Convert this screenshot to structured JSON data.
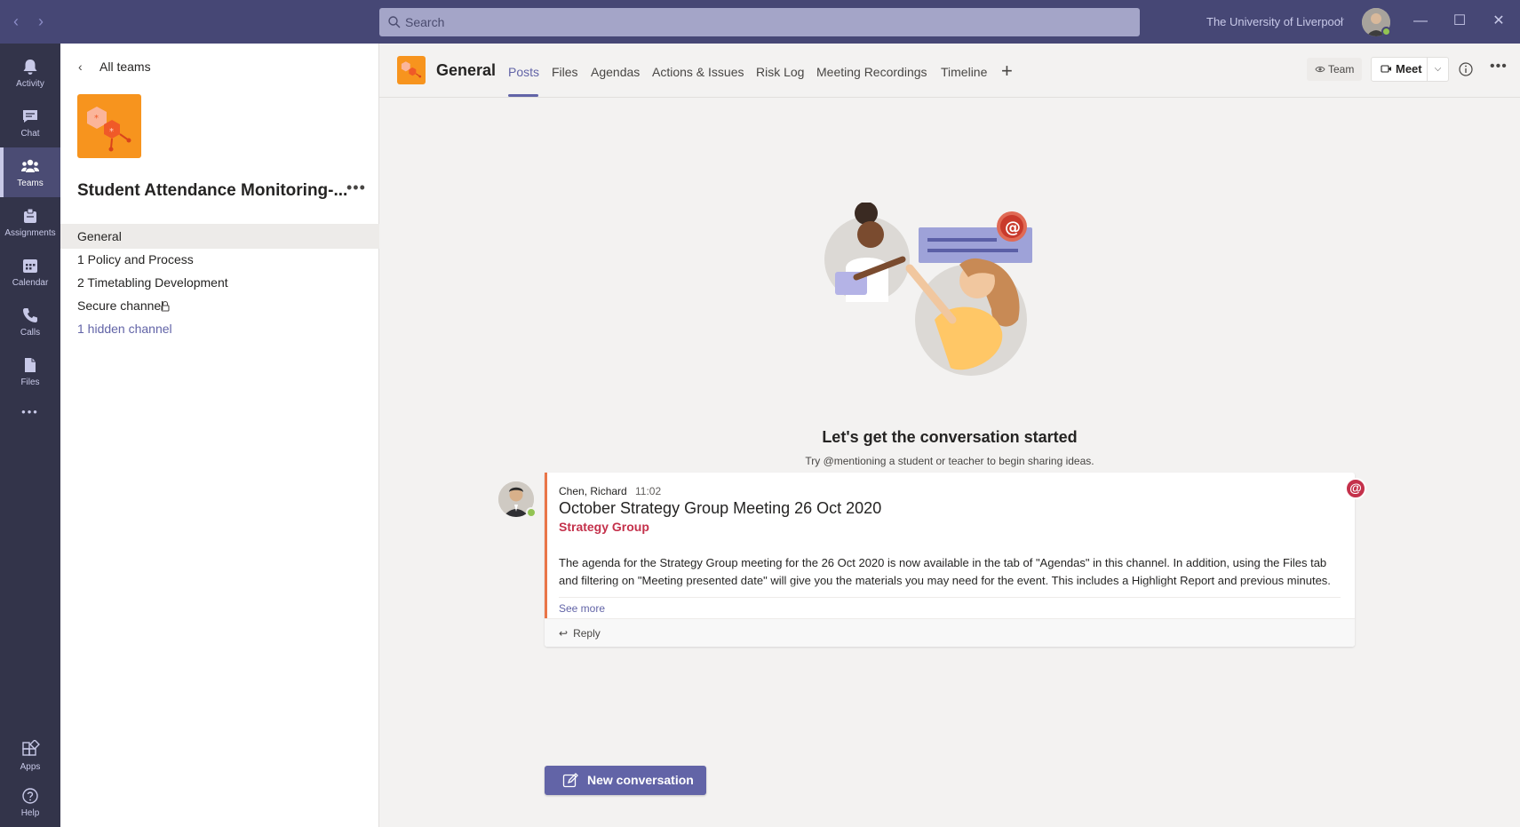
{
  "titlebar": {
    "search_placeholder": "Search",
    "org_name": "The University of Liverpool",
    "back_glyph": "‹",
    "forward_glyph": "›",
    "org_chevron": "⌵",
    "minimize_glyph": "—",
    "maximize_glyph": "☐",
    "close_glyph": "✕"
  },
  "rail": {
    "items": [
      {
        "label": "Activity",
        "icon": "bell-icon"
      },
      {
        "label": "Chat",
        "icon": "chat-icon"
      },
      {
        "label": "Teams",
        "icon": "teams-icon"
      },
      {
        "label": "Assignments",
        "icon": "assignments-icon"
      },
      {
        "label": "Calendar",
        "icon": "calendar-icon"
      },
      {
        "label": "Calls",
        "icon": "phone-icon"
      },
      {
        "label": "Files",
        "icon": "file-icon"
      }
    ],
    "more_glyph": "•••",
    "apps_label": "Apps",
    "help_label": "Help"
  },
  "pane": {
    "back_label": "All teams",
    "back_glyph": "‹",
    "team_name": "Student Attendance Monitoring-...",
    "more_glyph": "•••",
    "channels": [
      "General",
      "1 Policy and Process",
      "2 Timetabling Development",
      "Secure channel",
      "1 hidden channel"
    ]
  },
  "header": {
    "channel_title": "General",
    "tabs": [
      "Posts",
      "Files",
      "Agendas",
      "Actions & Issues",
      "Risk Log",
      "Meeting Recordings",
      "Timeline"
    ],
    "add_tab_glyph": "+",
    "team_button": "Team",
    "meet_button": "Meet",
    "meet_dropdown_glyph": "⌵",
    "more_glyph": "•••"
  },
  "empty_state": {
    "title": "Let's get the conversation started",
    "subtitle": "Try @mentioning a student or teacher to begin sharing ideas."
  },
  "post": {
    "author": "Chen, Richard",
    "time": "11:02",
    "subject": "October Strategy Group Meeting 26 Oct 2020",
    "tag": "Strategy Group",
    "body": "The agenda for the Strategy Group meeting for the 26 Oct 2020 is now available in the tab of \"Agendas\" in this channel.  In addition, using the Files tab and filtering on \"Meeting presented date\" will give you the materials you may need for the event. This includes a Highlight Report and previous minutes.",
    "see_more": "See more",
    "reply": "Reply",
    "reply_glyph": "↩",
    "mention_glyph": "@"
  },
  "compose": {
    "new_conversation": "New conversation"
  },
  "colors": {
    "brand": "#6264a7",
    "titlebar": "#464775",
    "rail": "#33344a",
    "team_logo": "#f7941e",
    "urgent": "#c4314b",
    "accent_bar": "#e97548"
  }
}
